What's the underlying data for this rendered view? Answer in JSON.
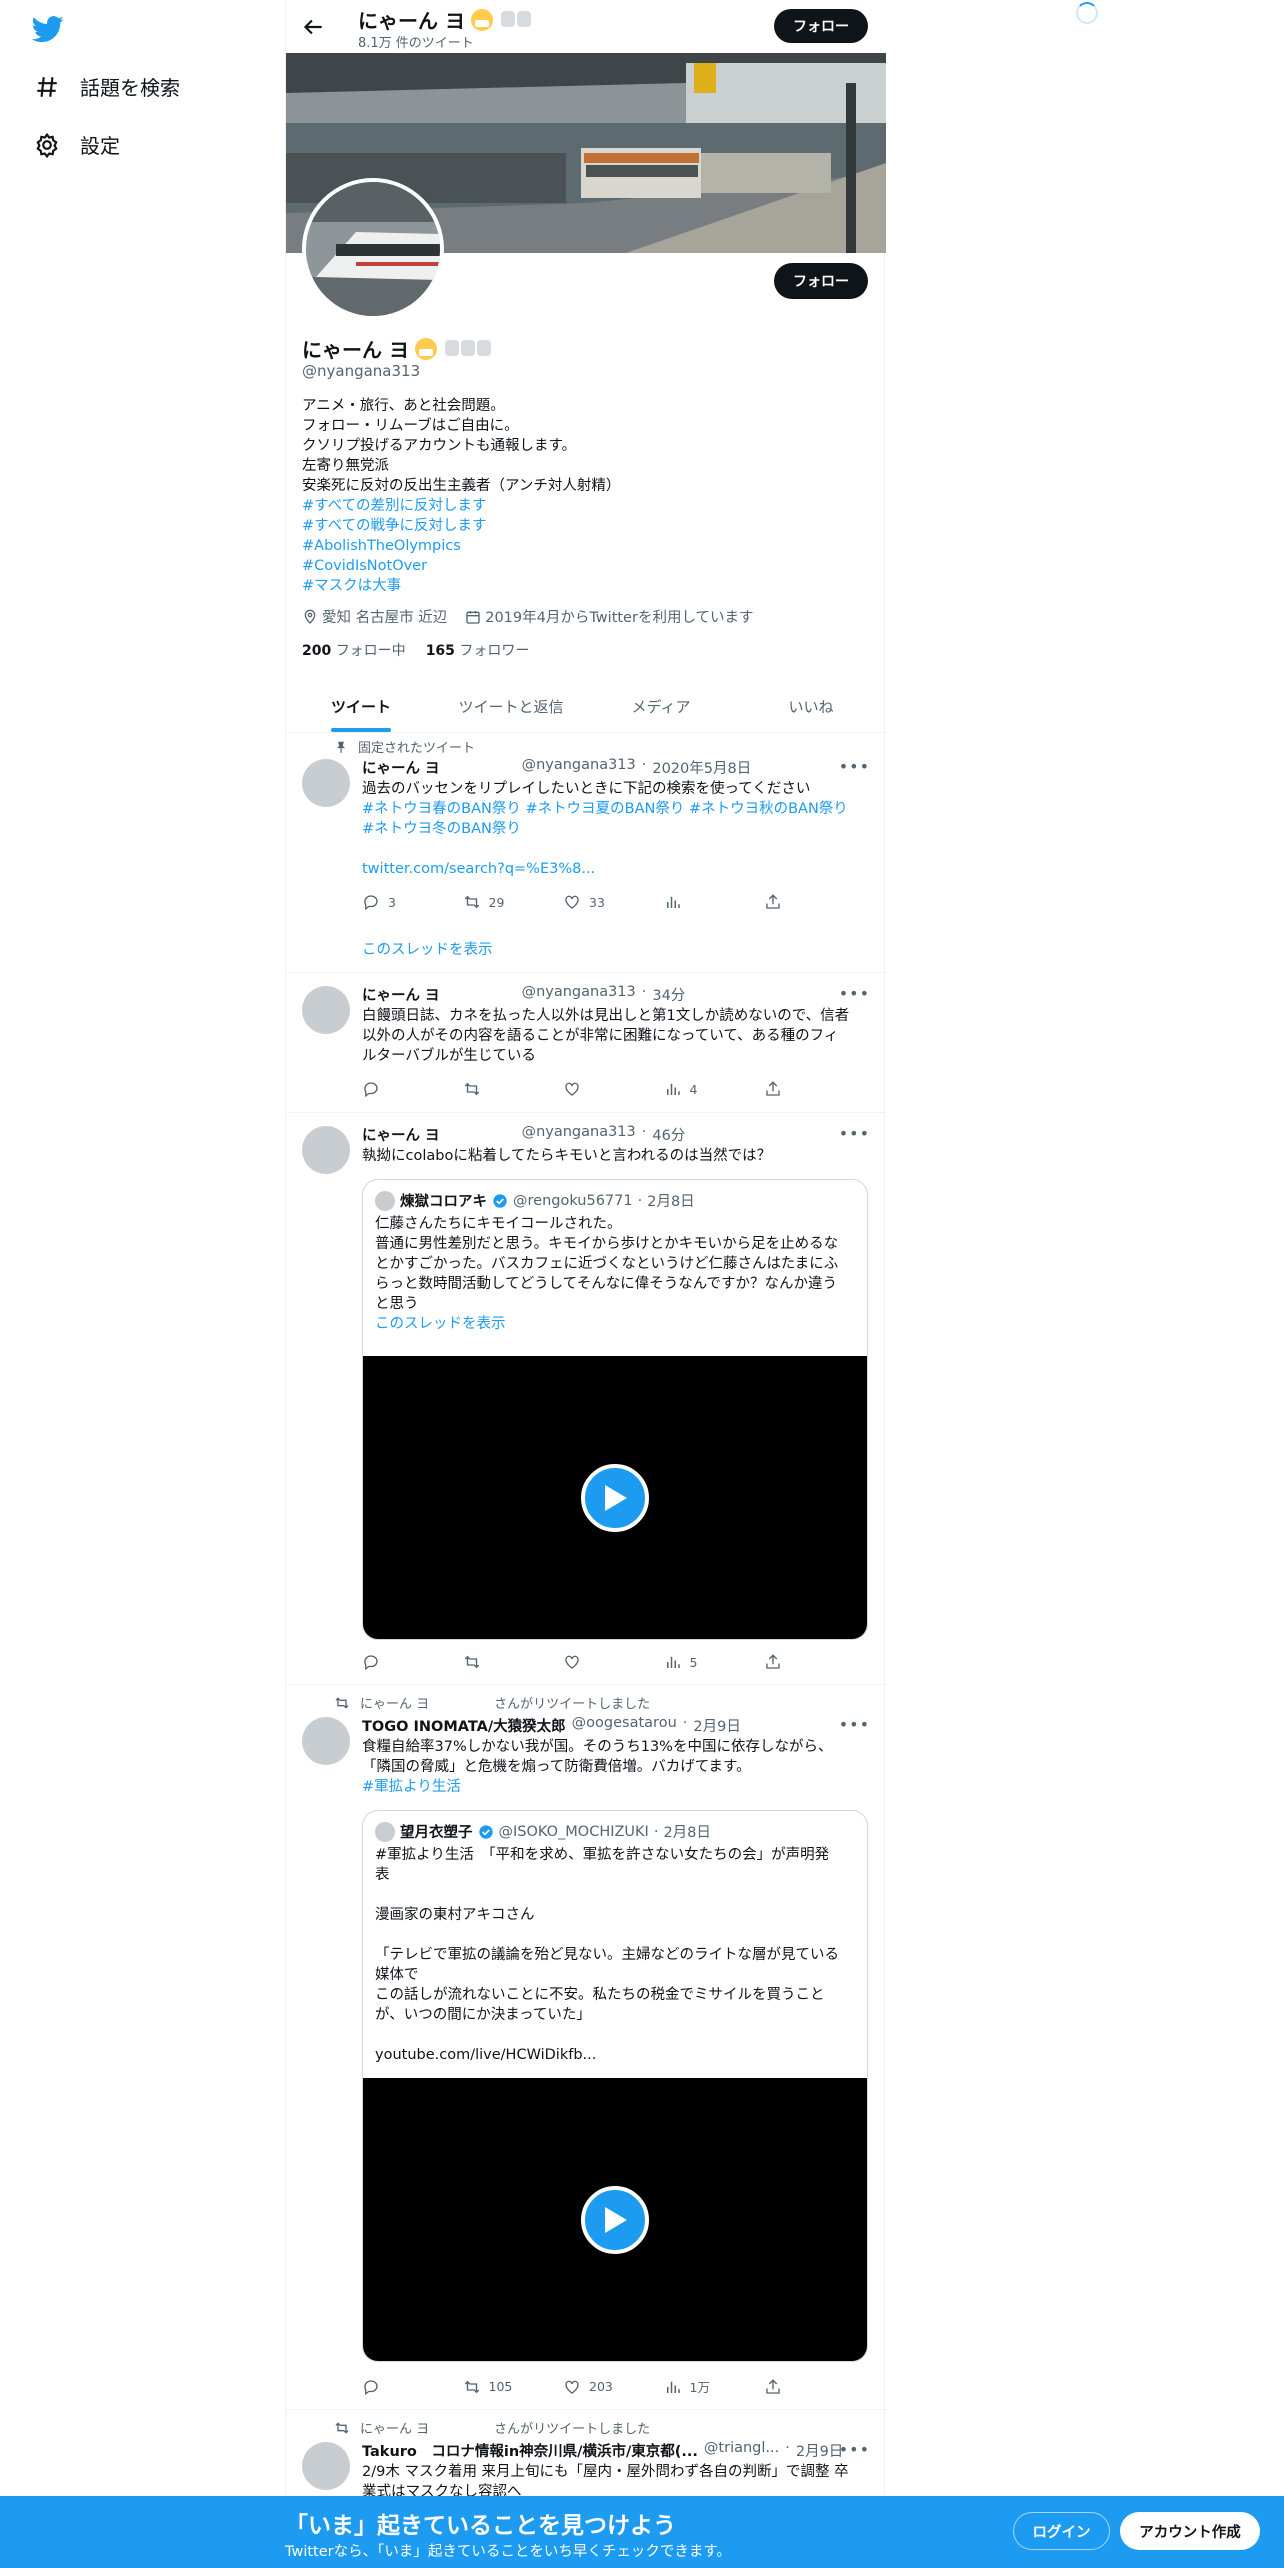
{
  "nav": {
    "explore": "話題を検索",
    "settings": "設定"
  },
  "header": {
    "name": "にゃーん ヨ",
    "tweet_count": "8.1万 件のツイート",
    "follow": "フォロー"
  },
  "profile": {
    "name": "にゃーん ヨ",
    "handle": "@nyangana313",
    "follow": "フォロー",
    "bio": [
      "アニメ・旅行、あと社会問題。",
      "フォロー・リムーブはご自由に。",
      "クソリプ投げるアカウントも通報します。",
      "左寄り無党派",
      "安楽死に反対の反出生主義者（アンチ対人射精）"
    ],
    "hashtags": [
      "#すべての差別に反対します",
      "#すべての戦争に反対します",
      "#AbolishTheOlympics",
      "#CovidIsNotOver",
      "#マスクは大事"
    ],
    "location": "愛知 名古屋市 近辺",
    "joined": "2019年4月からTwitterを利用しています",
    "following_count": "200",
    "following_label": "フォロー中",
    "followers_count": "165",
    "followers_label": "フォロワー"
  },
  "tabs": [
    "ツイート",
    "ツイートと返信",
    "メディア",
    "いいね"
  ],
  "tweets": [
    {
      "context": "固定されたツイート",
      "name": "にゃーん ヨ",
      "handle": "@nyangana313",
      "time": "2020年5月8日",
      "text": [
        "過去のバッセンをリプレイしたいときに下記の検索を使ってください"
      ],
      "tags": [
        "#ネトウヨ春のBAN祭り #ネトウヨ夏のBAN祭り #ネトウヨ秋のBAN祭り",
        "#ネトウヨ冬のBAN祭り"
      ],
      "link": "twitter.com/search?q=%E3%8...",
      "replies": "3",
      "retweets": "29",
      "likes": "33",
      "thread": "このスレッドを表示"
    },
    {
      "name": "にゃーん ヨ",
      "handle": "@nyangana313",
      "time": "34分",
      "text": [
        "白饅頭日誌、カネを払った人以外は見出しと第1文しか読めないので、信者",
        "以外の人がその内容を語ることが非常に困難になっていて、ある種のフィ",
        "ルターバブルが生じている"
      ],
      "views": "4"
    },
    {
      "name": "にゃーん ヨ",
      "handle": "@nyangana313",
      "time": "46分",
      "text": [
        "執拗にcolaboに粘着してたらキモいと言われるのは当然では？"
      ],
      "quote": {
        "name": "煉獄コロアキ",
        "handle": "@rengoku56771",
        "time": "2月8日",
        "text": [
          "仁藤さんたちにキモイコールされた。",
          "普通に男性差別だと思う。キモイから歩けとかキモいから足を止めるな",
          "とかすごかった。バスカフェに近づくなというけど仁藤さんはたまにふ",
          "らっと数時間活動してどうしてそんなに偉そうなんですか？なんか違う",
          "と思う"
        ],
        "thread": "このスレッドを表示"
      },
      "views": "5"
    },
    {
      "context": "にゃーん ヨ　　　　　さんがリツイートしました",
      "name": "TOGO INOMATA/大猿猤太郎",
      "handle": "@oogesatarou",
      "time": "2月9日",
      "text": [
        "食糧自給率37%しかない我が国。そのうち13%を中国に依存しながら、",
        "「隣国の脅威」と危機を煽って防衛費倍増。バカげてます。"
      ],
      "tags": [
        "#軍拡より生活"
      ],
      "quote": {
        "name": "望月衣塑子",
        "handle": "@ISOKO_MOCHIZUKI",
        "time": "2月8日",
        "text": [
          "#軍拡より生活　「平和を求め、軍拡を許さない女たちの会」が声明発",
          "表",
          "",
          "漫画家の東村アキコさん",
          "",
          "「テレビで軍拡の議論を殆ど見ない。主婦などのライトな層が見ている",
          "媒体で",
          "この話しが流れないことに不安。私たちの税金でミサイルを買うこと",
          "が、いつの間にか決まっていた」",
          "",
          "youtube.com/live/HCWiDikfb..."
        ]
      },
      "retweets": "105",
      "likes": "203",
      "views": "1万"
    },
    {
      "context": "にゃーん ヨ　　　　　さんがリツイートしました",
      "name": "Takuro　コロナ情報in神奈川県/横浜市/東京都(...",
      "handle": "@triangl...",
      "time": "2月9日",
      "text": [
        "2/9木 マスク着用 来月上旬にも「屋内・屋外問わず各自の判断」で調整 卒",
        "業式はマスクなし容認へ"
      ]
    }
  ],
  "bottom": {
    "title": "「いま」起きていることを見つけよう",
    "subtitle": "Twitterなら、「いま」起きていることをいち早くチェックできます。",
    "login": "ログイン",
    "signup": "アカウント作成"
  }
}
